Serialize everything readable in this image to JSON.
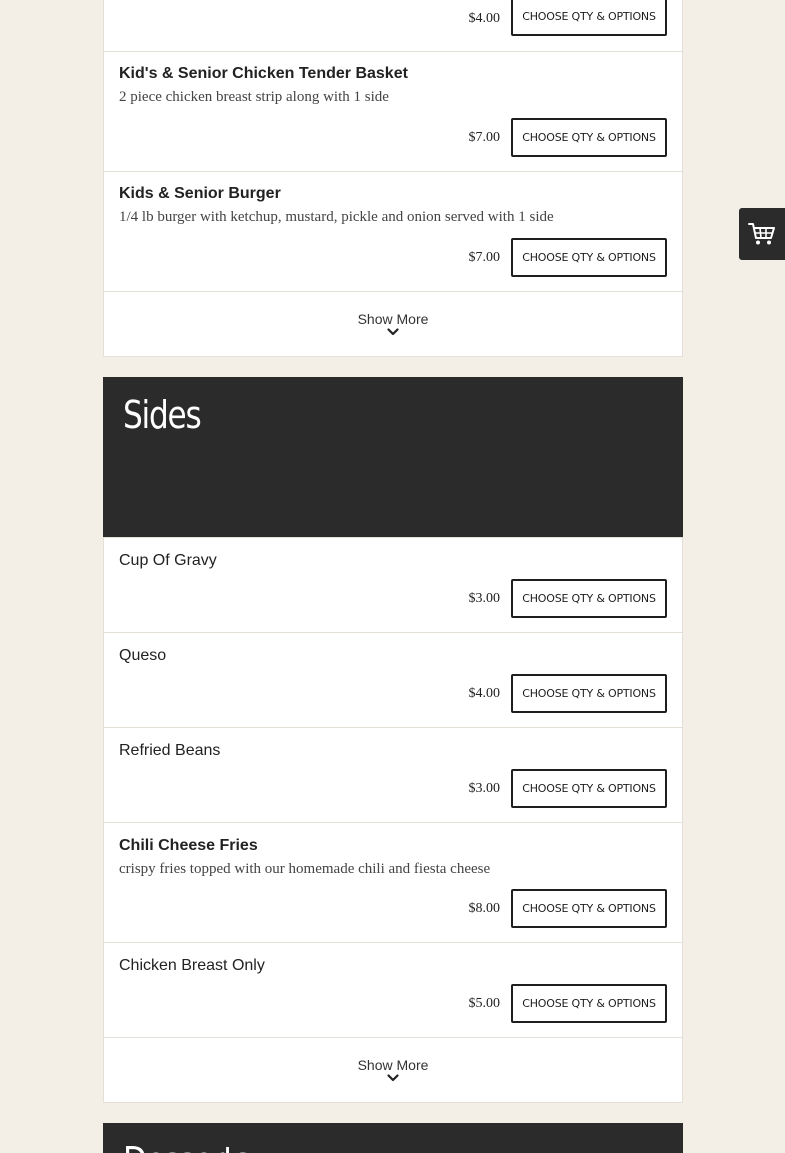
{
  "top_card": {
    "items": [
      {
        "name": "",
        "description": "",
        "price": "$4.00",
        "button_label": "CHOOSE QTY & OPTIONS"
      },
      {
        "name": "Kid's & Senior Chicken Tender Basket",
        "description": "2 piece chicken breast strip along with 1 side",
        "price": "$7.00",
        "button_label": "CHOOSE QTY & OPTIONS"
      },
      {
        "name": "Kids & Senior Burger",
        "description": "1/4 lb burger with ketchup, mustard, pickle and onion served with 1 side",
        "price": "$7.00",
        "button_label": "CHOOSE QTY & OPTIONS"
      }
    ],
    "show_more_label": "Show More"
  },
  "sides": {
    "title": "Sides",
    "items": [
      {
        "name": "Cup Of Gravy",
        "price": "$3.00",
        "button_label": "CHOOSE QTY & OPTIONS"
      },
      {
        "name": "Queso",
        "price": "$4.00",
        "button_label": "CHOOSE QTY & OPTIONS"
      },
      {
        "name": "Refried Beans",
        "price": "$3.00",
        "button_label": "CHOOSE QTY & OPTIONS"
      },
      {
        "name": "Chili Cheese Fries",
        "description": "crispy fries topped with our homemade chili and fiesta cheese",
        "price": "$8.00",
        "button_label": "CHOOSE QTY & OPTIONS"
      },
      {
        "name": "Chicken Breast Only",
        "price": "$5.00",
        "button_label": "CHOOSE QTY & OPTIONS"
      }
    ],
    "show_more_label": "Show More"
  },
  "next_section": {
    "title": "Desserts"
  },
  "icons": {
    "cart": "shopping-cart-icon",
    "show_more": "chevron-down-icon"
  },
  "colors": {
    "page_background": "#f4efe6",
    "section_header_background": "#2b2b2b",
    "card_background": "#ffffff",
    "button_border": "#1e1e1e"
  }
}
